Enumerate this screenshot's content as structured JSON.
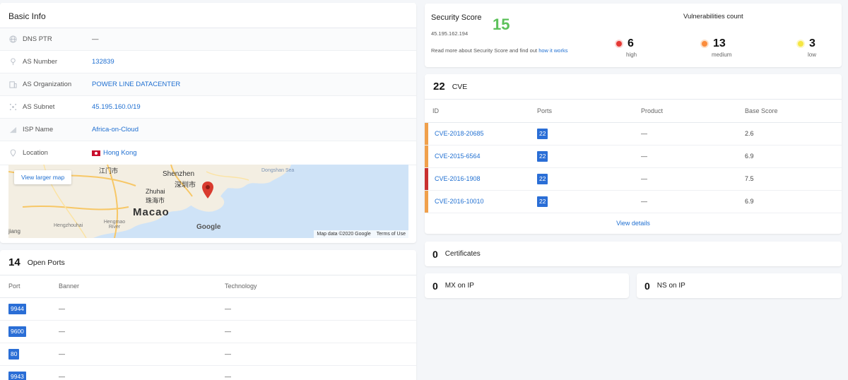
{
  "basic_info": {
    "title": "Basic Info",
    "rows": [
      {
        "label": "DNS PTR",
        "value": "—",
        "icon": "globe-icon"
      },
      {
        "label": "AS Number",
        "value": "132839",
        "icon": "pin-icon"
      },
      {
        "label": "AS Organization",
        "value": "POWER LINE DATACENTER",
        "icon": "building-icon"
      },
      {
        "label": "AS Subnet",
        "value": "45.195.160.0/19",
        "icon": "network-icon"
      },
      {
        "label": "ISP Name",
        "value": "Africa-on-Cloud",
        "icon": "signal-icon"
      },
      {
        "label": "Location",
        "value": "Hong Kong",
        "icon": "location-icon"
      }
    ],
    "map": {
      "button": "View larger map",
      "labels": [
        "Shenzhen",
        "深圳市",
        "Zhuhai",
        "珠海市",
        "Macao",
        "Dongshan Sea",
        "江门市",
        "Hengzhouhai",
        "Hengmao River",
        "jiang"
      ],
      "google": "Google",
      "map_data": "Map data ©2020 Google",
      "terms": "Terms of Use"
    }
  },
  "open_ports": {
    "count": "14",
    "label": "Open Ports",
    "columns": [
      "Port",
      "Banner",
      "Technology"
    ],
    "rows": [
      {
        "port": "9944",
        "banner": "—",
        "technology": "—"
      },
      {
        "port": "9600",
        "banner": "—",
        "technology": "—"
      },
      {
        "port": "80",
        "banner": "—",
        "technology": "—"
      },
      {
        "port": "9943",
        "banner": "—",
        "technology": "—"
      }
    ]
  },
  "security": {
    "title": "Security Score",
    "score": "15",
    "ip": "45.195.162.194",
    "more_text": "Read more about Security Score and find out",
    "more_link": "how it works",
    "vuln_title": "Vulnerabilities count",
    "vulns": [
      {
        "count": "6",
        "label": "high",
        "color": "#e53935"
      },
      {
        "count": "13",
        "label": "medium",
        "color": "#fb8c3c"
      },
      {
        "count": "3",
        "label": "low",
        "color": "#f5e642"
      }
    ],
    "score_color": "#5cc15a"
  },
  "cve": {
    "count": "22",
    "label": "CVE",
    "columns": [
      "ID",
      "Ports",
      "Product",
      "Base Score"
    ],
    "rows": [
      {
        "id": "CVE-2018-20685",
        "port": "22",
        "product": "—",
        "score": "2.6",
        "severity_color": "#f0a04b"
      },
      {
        "id": "CVE-2015-6564",
        "port": "22",
        "product": "—",
        "score": "6.9",
        "severity_color": "#f0a04b"
      },
      {
        "id": "CVE-2016-1908",
        "port": "22",
        "product": "—",
        "score": "7.5",
        "severity_color": "#c93030"
      },
      {
        "id": "CVE-2016-10010",
        "port": "22",
        "product": "—",
        "score": "6.9",
        "severity_color": "#f0a04b"
      }
    ],
    "view_details": "View details"
  },
  "certificates": {
    "count": "0",
    "label": "Certificates"
  },
  "mx": {
    "count": "0",
    "label": "MX on IP"
  },
  "ns": {
    "count": "0",
    "label": "NS on IP"
  }
}
